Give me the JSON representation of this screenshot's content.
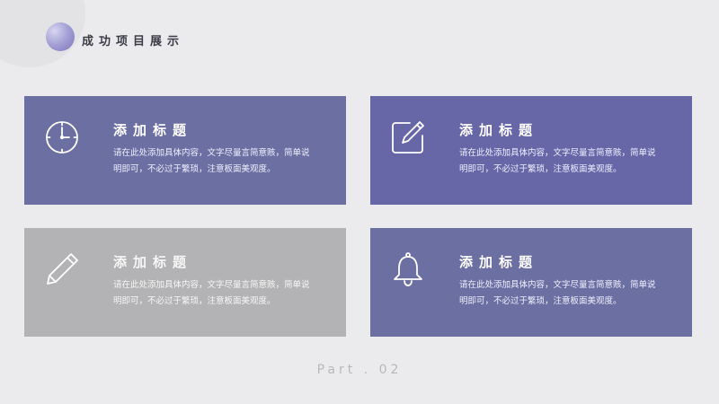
{
  "header": {
    "title": "成功项目展示"
  },
  "cards": [
    {
      "icon": "clock-icon",
      "title": "添加标题",
      "text": "请在此处添加具体内容，文字尽量言简意赅，简单说明即可，不必过于繁琐，注意板面美观度。"
    },
    {
      "icon": "edit-icon",
      "title": "添加标题",
      "text": "请在此处添加具体内容，文字尽量言简意赅，简单说明即可，不必过于繁琐，注意板面美观度。"
    },
    {
      "icon": "pencil-icon",
      "title": "添加标题",
      "text": "请在此处添加具体内容，文字尽量言简意赅，简单说明即可，不必过于繁琐，注意板面美观度。"
    },
    {
      "icon": "bell-icon",
      "title": "添加标题",
      "text": "请在此处添加具体内容，文字尽量言简意赅，简单说明即可，不必过于繁琐，注意板面美观度。"
    }
  ],
  "footer": {
    "label": "Part . 02"
  },
  "colors": {
    "background": "#ebebed",
    "card_blue": "#6c6fa1",
    "card_purple": "#6767a8",
    "card_gray": "#b3b3b5"
  }
}
